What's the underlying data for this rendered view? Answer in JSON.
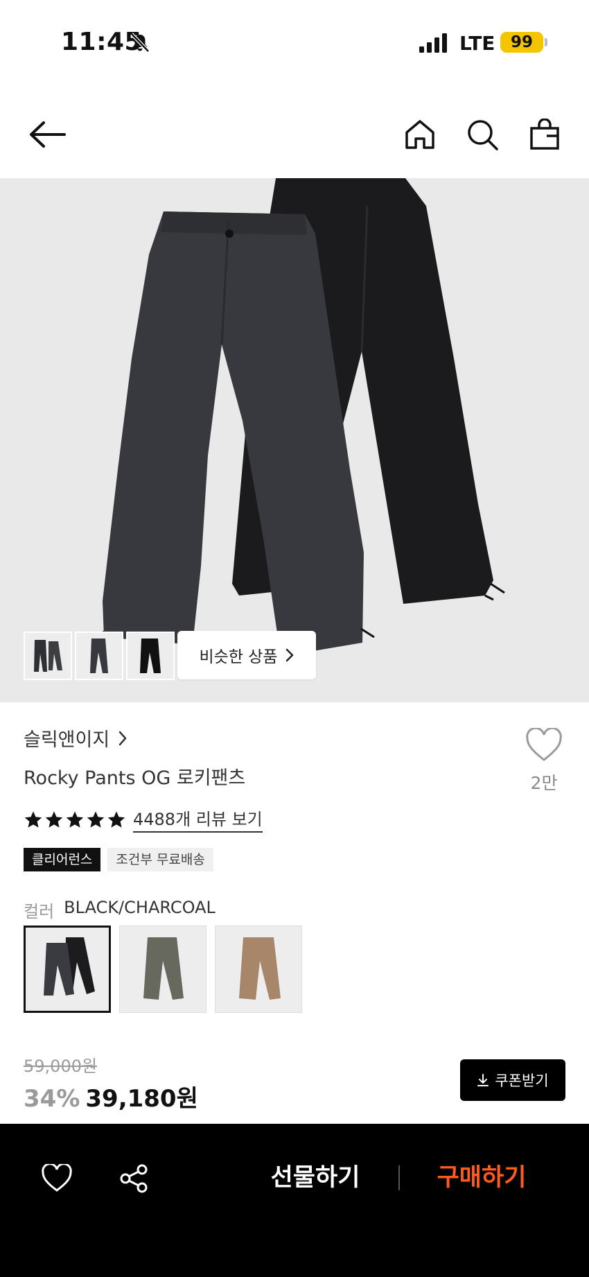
{
  "status_bar": {
    "time": "11:45",
    "network": "LTE",
    "battery": "99"
  },
  "nav": {
    "back_icon": "arrow-left-icon",
    "home_icon": "home-icon",
    "search_icon": "search-icon",
    "bag_icon": "shopping-bag-icon"
  },
  "gallery": {
    "similar_label": "비슷한 상품",
    "thumbnail_count": 3
  },
  "product": {
    "brand": "슬릭앤이지",
    "title": "Rocky Pants OG 로키팬츠",
    "likes": "2만",
    "rating_stars": 5,
    "review_link": "4488개 리뷰 보기",
    "badges": [
      "클리어런스",
      "조건부 무료배송"
    ],
    "color_label": "컬러",
    "color_value": "BLACK/CHARCOAL",
    "swatches": [
      {
        "name": "BLACK/CHARCOAL",
        "colors": [
          "#3a3b40",
          "#1c1c1e"
        ],
        "selected": true
      },
      {
        "name": "GRAY",
        "colors": [
          "#67695f"
        ],
        "selected": false
      },
      {
        "name": "BEIGE",
        "colors": [
          "#a8866a"
        ],
        "selected": false
      }
    ],
    "original_price": "59,000원",
    "discount": "34%",
    "sale_price": "39,180원",
    "coupon_label": "쿠폰받기"
  },
  "bottom_bar": {
    "gift_label": "선물하기",
    "buy_label": "구매하기",
    "buy_color": "#ff5a1f"
  },
  "colors": {
    "accent": "#ff5a1f",
    "battery": "#f5c400"
  }
}
